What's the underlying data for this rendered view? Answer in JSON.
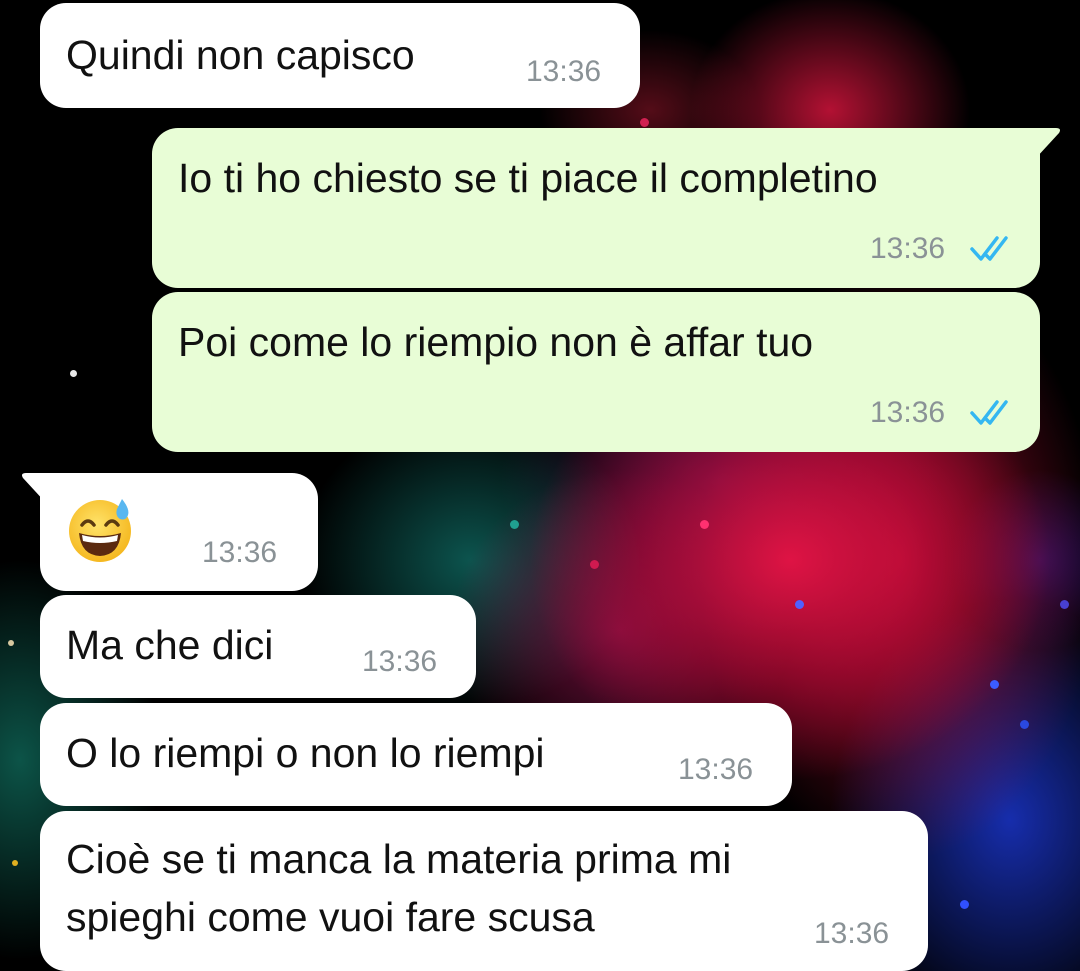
{
  "colors": {
    "incoming_bubble": "#ffffff",
    "outgoing_bubble": "#e8fdd6",
    "timestamp": "#8a9296",
    "read_ticks": "#34b7f1"
  },
  "messages": [
    {
      "direction": "incoming",
      "text": "Quindi non capisco",
      "time": "13:36"
    },
    {
      "direction": "outgoing",
      "text": "Io ti ho chiesto se ti piace il completino",
      "time": "13:36",
      "status": "read"
    },
    {
      "direction": "outgoing",
      "text": "Poi come lo riempio non è affar tuo",
      "time": "13:36",
      "status": "read"
    },
    {
      "direction": "incoming",
      "emoji": "grinning-face-with-sweat",
      "time": "13:36"
    },
    {
      "direction": "incoming",
      "text": "Ma che dici",
      "time": "13:36"
    },
    {
      "direction": "incoming",
      "text": "O lo riempi o non lo riempi",
      "time": "13:36"
    },
    {
      "direction": "incoming",
      "text_lines": [
        "Cioè se ti manca la materia prima mi",
        "spieghi come vuoi fare scusa"
      ],
      "time": "13:36"
    }
  ]
}
